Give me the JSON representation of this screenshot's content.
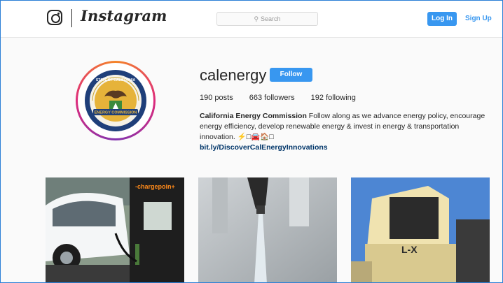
{
  "header": {
    "logo_icon": "instagram-camera-icon",
    "wordmark": "Instagram",
    "search_placeholder": "Search",
    "login_label": "Log In",
    "signup_label": "Sign Up",
    "accent": "#3897f0"
  },
  "profile": {
    "username": "calenergy",
    "follow_label": "Follow",
    "posts": "190 posts",
    "followers": "663 followers",
    "following": "192 following",
    "bio_name": "California Energy Commission",
    "bio_text": " Follow along as we advance energy policy, encourage energy efficiency, develop renewable energy & invest in energy & transportation innovation. ⚡□🚘🏠□",
    "bio_link": "bit.ly/DiscoverCalEnergyInnovations",
    "avatar": {
      "seal_top": "STATE OF CALIFORNIA",
      "seal_bottom": "ENERGY COMMISSION"
    }
  },
  "posts": [
    {
      "name": "post-ev-charging",
      "brand": "-chargepoin+"
    },
    {
      "name": "post-water-faucet"
    },
    {
      "name": "post-construction-machine",
      "machine_label": "L-X"
    }
  ]
}
